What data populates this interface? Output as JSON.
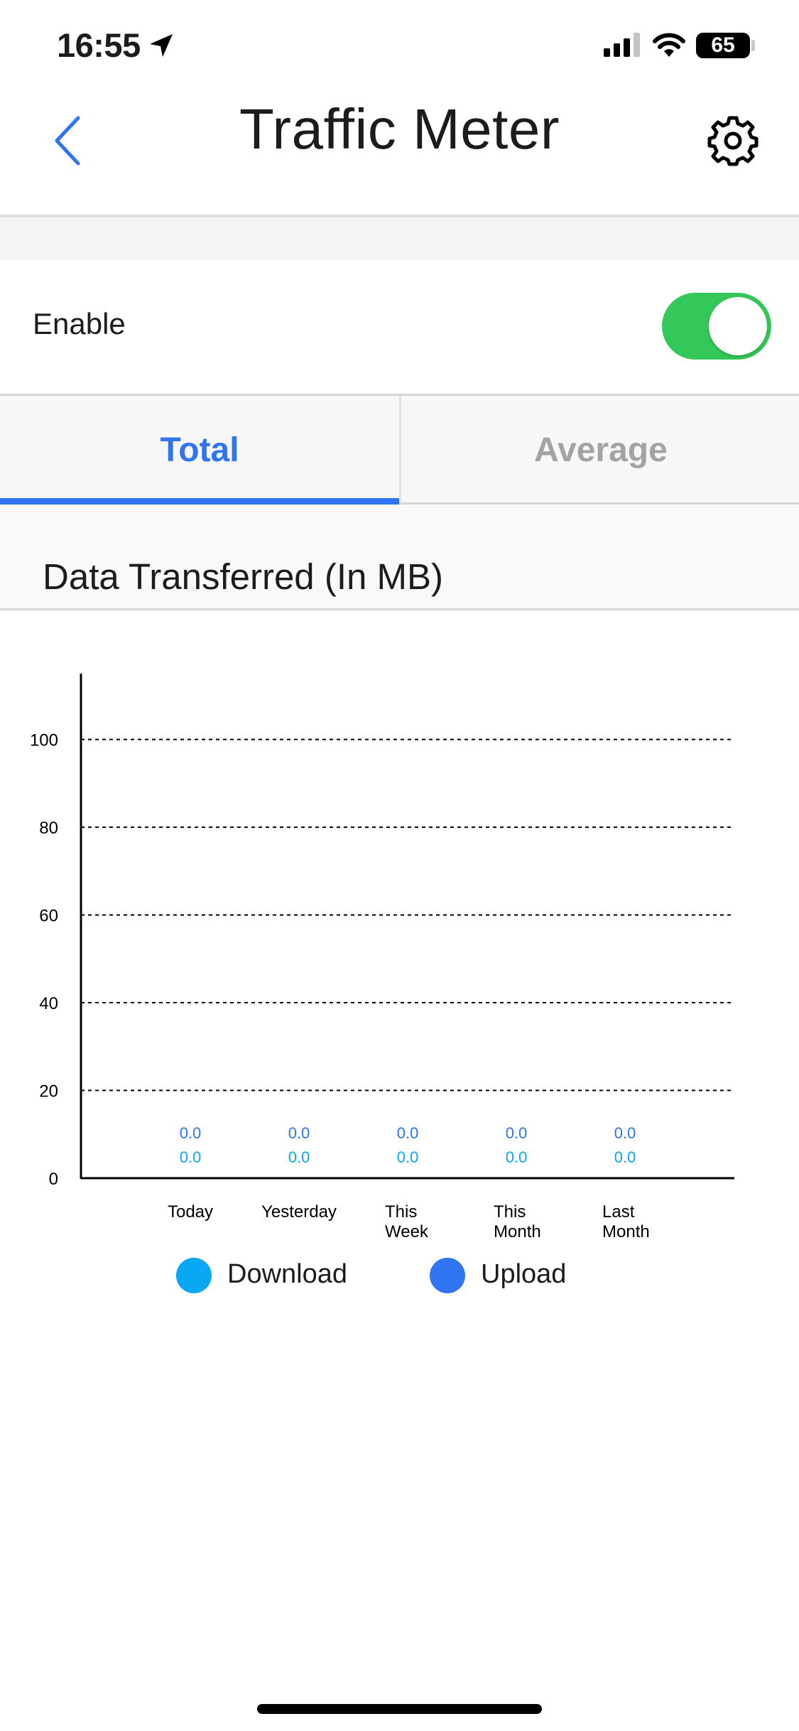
{
  "status_bar": {
    "time": "16:55",
    "battery": "65"
  },
  "nav": {
    "title": "Traffic Meter"
  },
  "enable_row": {
    "label": "Enable",
    "toggle_on": true,
    "toggle_color": "#34c759"
  },
  "tabs": [
    {
      "label": "Total",
      "active": true
    },
    {
      "label": "Average",
      "active": false
    }
  ],
  "colors": {
    "accent": "#2f74f0",
    "inactive_tab": "#a3a3a3"
  },
  "section_header": "Data Transferred (In MB)",
  "chart_data": {
    "type": "bar",
    "categories": [
      "Today",
      "Yesterday",
      "This Week",
      "This Month",
      "Last Month"
    ],
    "category_labels": [
      [
        "Today"
      ],
      [
        "Yesterday"
      ],
      [
        "This",
        "Week"
      ],
      [
        "This",
        "Month"
      ],
      [
        "Last",
        "Month"
      ]
    ],
    "series": [
      {
        "name": "Download",
        "color": "#08a8f5",
        "values": [
          0.0,
          0.0,
          0.0,
          0.0,
          0.0
        ],
        "labels": [
          "0.0",
          "0.0",
          "0.0",
          "0.0",
          "0.0"
        ]
      },
      {
        "name": "Upload",
        "color": "#2f74f0",
        "values": [
          0.0,
          0.0,
          0.0,
          0.0,
          0.0
        ],
        "labels": [
          "0.0",
          "0.0",
          "0.0",
          "0.0",
          "0.0"
        ]
      }
    ],
    "y_ticks": [
      "0",
      "20",
      "40",
      "60",
      "80",
      "100"
    ],
    "ylim": [
      0,
      115
    ],
    "grid": true,
    "legend_position": "bottom"
  }
}
